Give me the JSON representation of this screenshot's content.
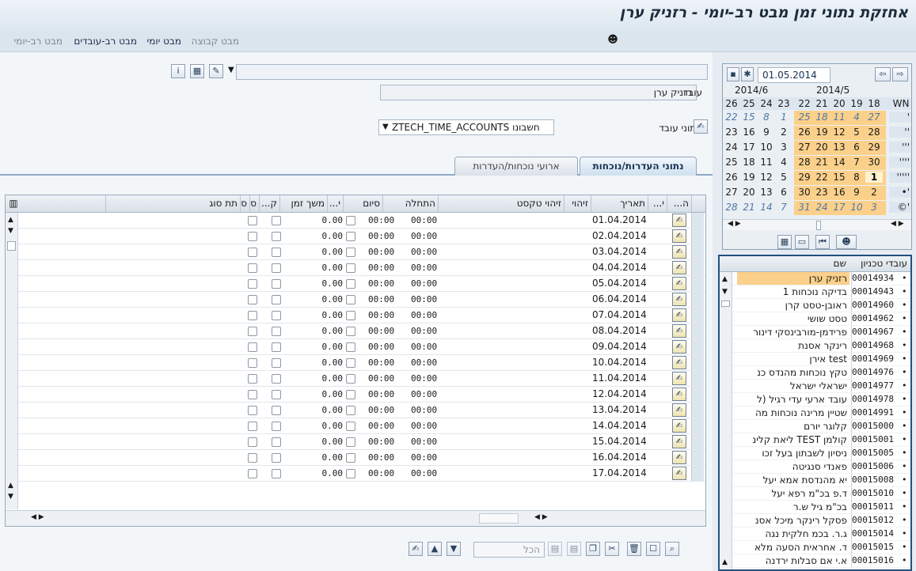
{
  "window": {
    "title": "אחזקת נתוני זמן מבט רב-יומי - רזניק ערן"
  },
  "menu": {
    "items": [
      {
        "label": "מבט רב-יומי",
        "state": "dim"
      },
      {
        "label": "מבט רב-עובדים",
        "state": "active"
      },
      {
        "label": "מבט יומי",
        "state": "active"
      },
      {
        "label": "מבט קבוצה",
        "state": "dim"
      }
    ]
  },
  "employee": {
    "label": "עובד",
    "value": "רזניק ערן",
    "data_label": "נתוני עובד",
    "account": "ZTECH_TIME_ACCOUNTS חשבונו"
  },
  "tabs": [
    "נתוני העדרות/נוכחות",
    "ארועי נוכחות/העדרות"
  ],
  "grid": {
    "headers": {
      "h": "ה...",
      "i": "י...",
      "date": "תאריך",
      "id": "זיהוי",
      "idtext": "זיהוי טקסט",
      "start": "התחלה",
      "end": "סיום",
      "i2": "י...",
      "duration": "משך זמן",
      "k": "ק...",
      "s1": "ס.",
      "s2": "ס.",
      "subtype": "תת סוג"
    },
    "rows": [
      {
        "date": "01.04.2014",
        "start": "00:00",
        "end": "00:00",
        "duration": "0.00"
      },
      {
        "date": "02.04.2014",
        "start": "00:00",
        "end": "00:00",
        "duration": "0.00"
      },
      {
        "date": "03.04.2014",
        "start": "00:00",
        "end": "00:00",
        "duration": "0.00"
      },
      {
        "date": "04.04.2014",
        "start": "00:00",
        "end": "00:00",
        "duration": "0.00"
      },
      {
        "date": "05.04.2014",
        "start": "00:00",
        "end": "00:00",
        "duration": "0.00"
      },
      {
        "date": "06.04.2014",
        "start": "00:00",
        "end": "00:00",
        "duration": "0.00"
      },
      {
        "date": "07.04.2014",
        "start": "00:00",
        "end": "00:00",
        "duration": "0.00"
      },
      {
        "date": "08.04.2014",
        "start": "00:00",
        "end": "00:00",
        "duration": "0.00"
      },
      {
        "date": "09.04.2014",
        "start": "00:00",
        "end": "00:00",
        "duration": "0.00"
      },
      {
        "date": "10.04.2014",
        "start": "00:00",
        "end": "00:00",
        "duration": "0.00"
      },
      {
        "date": "11.04.2014",
        "start": "00:00",
        "end": "00:00",
        "duration": "0.00"
      },
      {
        "date": "12.04.2014",
        "start": "00:00",
        "end": "00:00",
        "duration": "0.00"
      },
      {
        "date": "13.04.2014",
        "start": "00:00",
        "end": "00:00",
        "duration": "0.00"
      },
      {
        "date": "14.04.2014",
        "start": "00:00",
        "end": "00:00",
        "duration": "0.00"
      },
      {
        "date": "15.04.2014",
        "start": "00:00",
        "end": "00:00",
        "duration": "0.00"
      },
      {
        "date": "16.04.2014",
        "start": "00:00",
        "end": "00:00",
        "duration": "0.00"
      },
      {
        "date": "17.04.2014",
        "start": "00:00",
        "end": "00:00",
        "duration": "0.00"
      }
    ]
  },
  "toolbar": {
    "filter_placeholder": "הכל"
  },
  "calendar": {
    "date": "01.05.2014",
    "month_left": "2014/6",
    "month_right": "2014/5",
    "week_header": "WN",
    "header_days": [
      "26",
      "25",
      "24",
      "23",
      "22",
      "21",
      "20",
      "19",
      "18"
    ],
    "rows": [
      {
        "wk": "'",
        "l": [
          "22",
          "15",
          "8",
          "1"
        ],
        "r": [
          "25",
          "18",
          "11",
          "4",
          "27"
        ],
        "style": "prev"
      },
      {
        "wk": "''",
        "l": [
          "23",
          "16",
          "9",
          "2"
        ],
        "r": [
          "26",
          "19",
          "12",
          "5",
          "28"
        ]
      },
      {
        "wk": "'''",
        "l": [
          "24",
          "17",
          "10",
          "3"
        ],
        "r": [
          "27",
          "20",
          "13",
          "6",
          "29"
        ]
      },
      {
        "wk": "''''",
        "l": [
          "25",
          "18",
          "11",
          "4"
        ],
        "r": [
          "28",
          "21",
          "14",
          "7",
          "30"
        ]
      },
      {
        "wk": "'''''",
        "l": [
          "26",
          "19",
          "12",
          "5"
        ],
        "r": [
          "29",
          "22",
          "15",
          "8",
          "1"
        ],
        "today": "1"
      },
      {
        "wk": "•'",
        "l": [
          "27",
          "20",
          "13",
          "6"
        ],
        "r": [
          "30",
          "23",
          "16",
          "9",
          "2"
        ]
      },
      {
        "wk": "©'",
        "l": [
          "28",
          "21",
          "14",
          "7"
        ],
        "r": [
          "31",
          "24",
          "17",
          "10",
          "3"
        ],
        "style": "next"
      }
    ]
  },
  "tech": {
    "header_id": "עובדי טכניון",
    "header_name": "שם",
    "rows": [
      {
        "id": "00014934",
        "name": "רזניק ערן",
        "sel": true
      },
      {
        "id": "00014943",
        "name": "בדיקה נוכחות 1"
      },
      {
        "id": "00014960",
        "name": "ראובן-טסט קרן"
      },
      {
        "id": "00014962",
        "name": "טסט שושי"
      },
      {
        "id": "00014967",
        "name": "פרידמן-מורבינסקי דינור"
      },
      {
        "id": "00014968",
        "name": "רינקר אסנת"
      },
      {
        "id": "00014969",
        "name": "test אירן"
      },
      {
        "id": "00014976",
        "name": "טקץ נוכחות מהנדס כנ"
      },
      {
        "id": "00014977",
        "name": "ישראלי ישראל"
      },
      {
        "id": "00014978",
        "name": "עובד ארעי עדי רגיל (ל"
      },
      {
        "id": "00014991",
        "name": "שטיין מרינה נוכחות מה"
      },
      {
        "id": "00015000",
        "name": "קלוגר יורם"
      },
      {
        "id": "00015001",
        "name": "קולמן TEST ליאת קלינ"
      },
      {
        "id": "00015005",
        "name": "ניסיון לשבתון בעל זכו"
      },
      {
        "id": "00015006",
        "name": "פאנדי סנגיטה"
      },
      {
        "id": "00015008",
        "name": "יא מהנדסת אמא יעל"
      },
      {
        "id": "00015010",
        "name": "ד.פ בכ\"מ רפא יעל"
      },
      {
        "id": "00015011",
        "name": "בכ\"מ גיל ש.ר"
      },
      {
        "id": "00015012",
        "name": "פסקל רינקר מיכל אסנ"
      },
      {
        "id": "00015014",
        "name": "ג.ר. בכמ חלקית נגה"
      },
      {
        "id": "00015015",
        "name": "ד. אחראית הסעה מלא"
      },
      {
        "id": "00015016",
        "name": "א.י אם סבלות ירדנה"
      }
    ]
  }
}
